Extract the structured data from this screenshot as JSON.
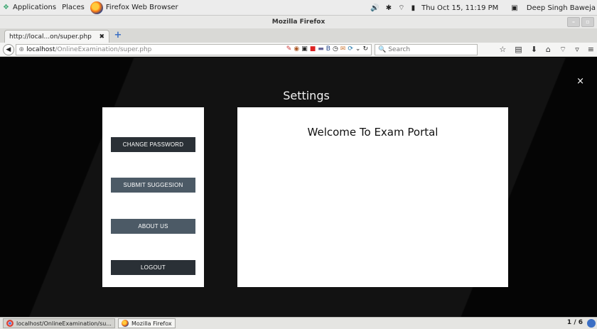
{
  "topbar": {
    "applications": "Applications",
    "places": "Places",
    "active_app": "Firefox Web Browser",
    "clock": "Thu Oct 15, 11:19 PM",
    "user": "Deep Singh Baweja"
  },
  "window": {
    "title": "Mozilla Firefox"
  },
  "tab": {
    "label": "http://local...on/super.php",
    "close": "✖"
  },
  "nav": {
    "url_host": "localhost",
    "url_path": "/OnlineExamination/super.php",
    "search_placeholder": "Search"
  },
  "page": {
    "title": "Settings",
    "close": "×",
    "menu": [
      "CHANGE PASSWORD",
      "SUBMIT SUGGESION",
      "ABOUT US",
      "LOGOUT"
    ],
    "welcome": "Welcome To Exam Portal"
  },
  "taskbar": {
    "tasks": [
      "localhost/OnlineExamination/su...",
      "Mozilla Firefox"
    ],
    "pager": "1 / 6"
  }
}
